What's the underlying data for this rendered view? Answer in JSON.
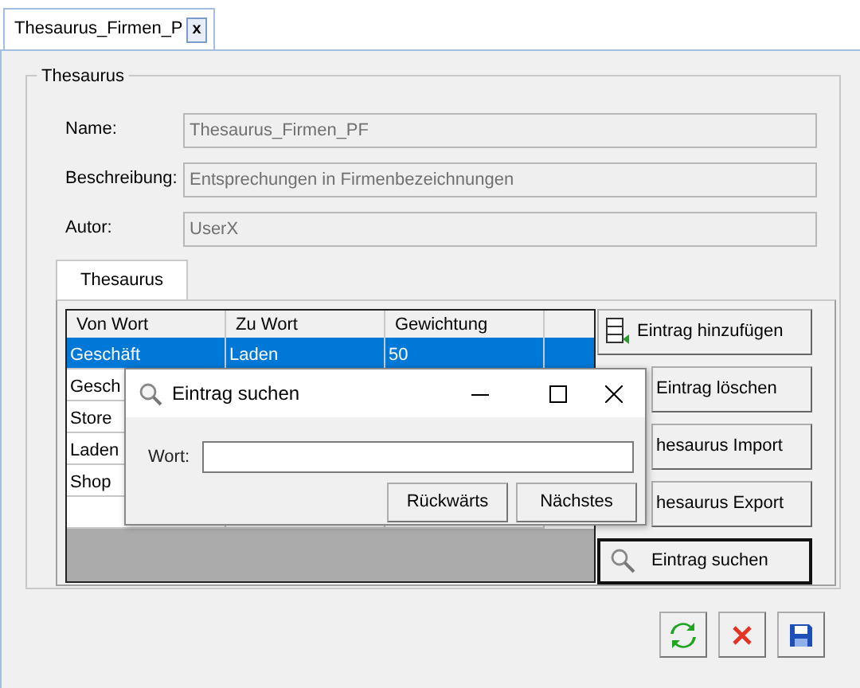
{
  "document_tabs": [
    {
      "label": "Thesaurus_Firmen_P",
      "close": "x",
      "selected": true
    }
  ],
  "group": {
    "title": "Thesaurus"
  },
  "fields": [
    {
      "label": "Name:",
      "value": "Thesaurus_Firmen_PF",
      "disabled": true
    },
    {
      "label": "Beschreibung:",
      "value": "Entsprechungen in Firmenbezeichnungen",
      "disabled": true
    },
    {
      "label": "Autor:",
      "value": "UserX",
      "disabled": true
    }
  ],
  "inner_tabs": [
    {
      "label": "Thesaurus",
      "selected": true
    }
  ],
  "table": {
    "columns": [
      "Von Wort",
      "Zu Wort",
      "Gewichtung"
    ],
    "rows": [
      {
        "cells": [
          "Geschäft",
          "Laden",
          "50"
        ],
        "selected": true
      },
      {
        "cells": [
          "Gesch"
        ],
        "selected": false
      },
      {
        "cells": [
          "Store"
        ],
        "selected": false
      },
      {
        "cells": [
          "Laden"
        ],
        "selected": false
      },
      {
        "cells": [
          "Shop"
        ],
        "selected": false
      }
    ]
  },
  "side_buttons": [
    {
      "label": "Eintrag hinzufügen",
      "kind": "add",
      "focused": false
    },
    {
      "label": "Eintrag löschen",
      "kind": "covered",
      "focused": false
    },
    {
      "label": "hesaurus Import",
      "kind": "covered",
      "focused": false
    },
    {
      "label": "hesaurus Export",
      "kind": "covered",
      "focused": false
    },
    {
      "label": "Eintrag suchen",
      "kind": "search",
      "focused": true
    }
  ],
  "dialog": {
    "title": "Eintrag suchen",
    "field_label": "Wort:",
    "buttons": [
      "Rückwärts",
      "Nächstes"
    ]
  }
}
